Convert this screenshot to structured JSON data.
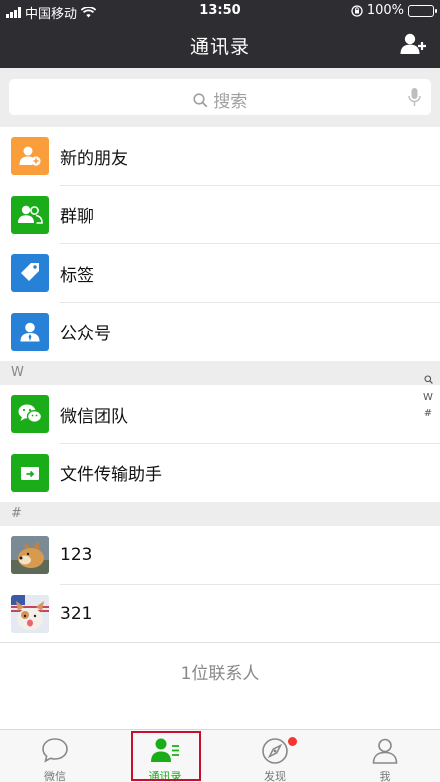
{
  "status_bar": {
    "carrier": "中国移动",
    "time": "13:50",
    "battery": "100%"
  },
  "nav": {
    "title": "通讯录",
    "add_icon": "add-contact-icon"
  },
  "search": {
    "placeholder": "搜索",
    "search_icon": "search-icon",
    "mic_icon": "microphone-icon"
  },
  "functions": [
    {
      "label": "新的朋友",
      "icon": "new-friends-icon",
      "color": "#fa9d3b"
    },
    {
      "label": "群聊",
      "icon": "group-chat-icon",
      "color": "#1aad19"
    },
    {
      "label": "标签",
      "icon": "tag-icon",
      "color": "#2782d7"
    },
    {
      "label": "公众号",
      "icon": "official-accounts-icon",
      "color": "#2782d7"
    }
  ],
  "sections": [
    {
      "letter": "W",
      "contacts": [
        {
          "name": "微信团队",
          "icon": "wechat-team-icon",
          "color": "#1aad19"
        },
        {
          "name": "文件传输助手",
          "icon": "file-transfer-icon",
          "color": "#1aad19"
        }
      ]
    },
    {
      "letter": "#",
      "contacts": [
        {
          "name": "123",
          "icon": "avatar-dog-icon"
        },
        {
          "name": "321",
          "icon": "avatar-corgi-icon"
        }
      ]
    }
  ],
  "contact_count": "1位联系人",
  "index_bar": [
    "W",
    "#"
  ],
  "tabs": [
    {
      "label": "微信",
      "icon": "chat-bubble-icon",
      "active": false
    },
    {
      "label": "通讯录",
      "icon": "contacts-icon",
      "active": true
    },
    {
      "label": "发现",
      "icon": "compass-icon",
      "active": false,
      "badge": true
    },
    {
      "label": "我",
      "icon": "me-icon",
      "active": false
    }
  ],
  "colors": {
    "nav_bg": "#2e2e32",
    "accent": "#1aad19",
    "badge": "#f43530"
  }
}
